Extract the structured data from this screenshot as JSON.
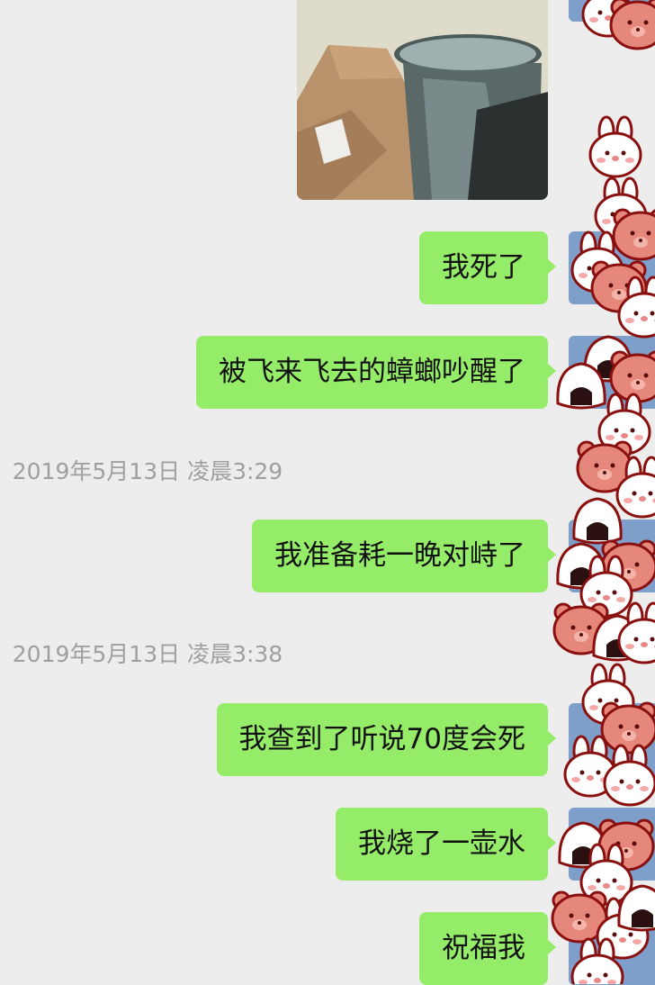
{
  "chat": {
    "messages": [
      {
        "type": "image",
        "sender": "self",
        "alt_icon": "photo-trash-bin"
      },
      {
        "type": "text",
        "sender": "self",
        "text": "我死了"
      },
      {
        "type": "text",
        "sender": "self",
        "text": "被飞来飞去的蟑螂吵醒了"
      },
      {
        "type": "timestamp",
        "text": "2019年5月13日 凌晨3:29"
      },
      {
        "type": "text",
        "sender": "self",
        "text": "我准备耗一晚对峙了"
      },
      {
        "type": "timestamp",
        "text": "2019年5月13日 凌晨3:38"
      },
      {
        "type": "text",
        "sender": "self",
        "text": "我查到了听说70度会死"
      },
      {
        "type": "text",
        "sender": "self",
        "text": "我烧了一壶水"
      },
      {
        "type": "text",
        "sender": "self",
        "text": "祝福我"
      }
    ]
  },
  "colors": {
    "background": "#ededed",
    "bubble_self": "#95ec69",
    "timestamp_text": "#9f9f9f",
    "sticker_pink": "#e6877c",
    "sticker_outline": "#8a1010"
  },
  "icons": {
    "avatar": "user-avatar-icon",
    "sticker": "bunny-bear-sticker-icon"
  }
}
